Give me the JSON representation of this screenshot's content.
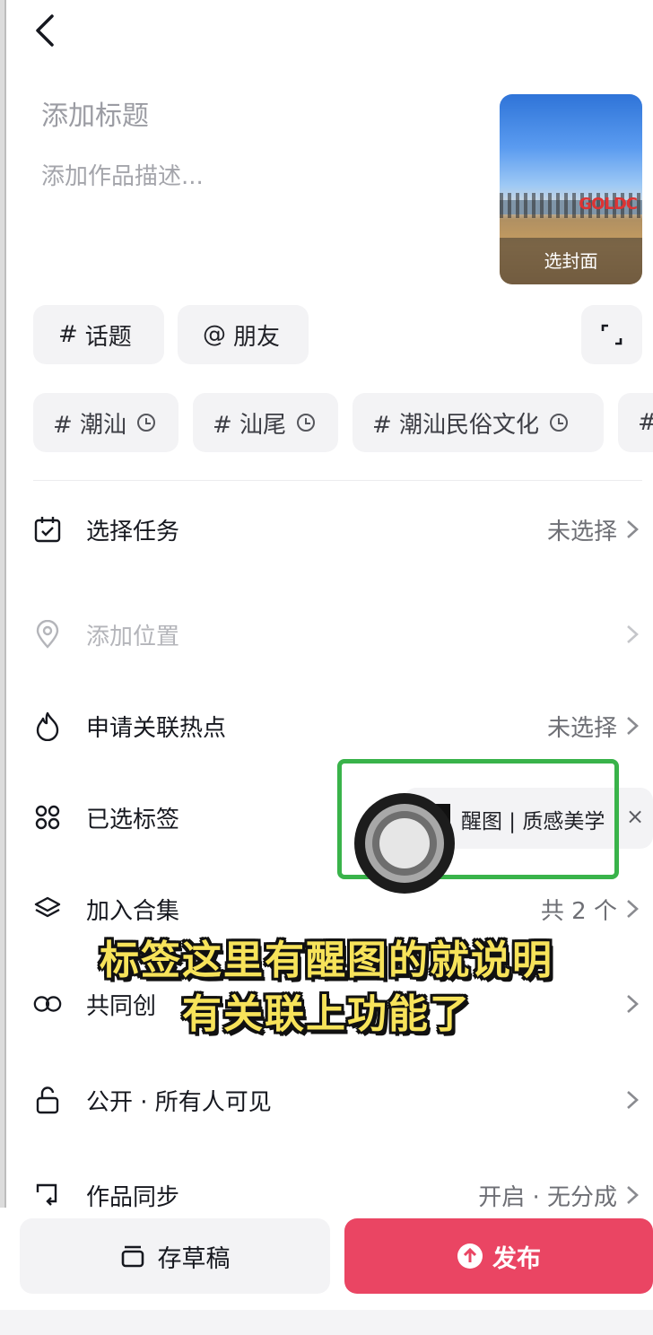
{
  "header": {
    "title_placeholder": "添加标题",
    "description_placeholder": "添加作品描述..."
  },
  "cover": {
    "label": "选封面",
    "sign_text": "GOLDC"
  },
  "toolbar": {
    "topic_label": "话题",
    "topic_icon": "#",
    "friend_label": "朋友",
    "friend_icon": "@"
  },
  "hashtags": [
    {
      "label": "# 潮汕"
    },
    {
      "label": "# 汕尾"
    },
    {
      "label": "# 潮汕民俗文化"
    },
    {
      "label": "#"
    }
  ],
  "settings": {
    "task": {
      "label": "选择任务",
      "value": "未选择"
    },
    "location": {
      "label": "添加位置"
    },
    "hotspot": {
      "label": "申请关联热点",
      "value": "未选择"
    },
    "selected_tags": {
      "label": "已选标签",
      "tag_text": "醒图 | 质感美学",
      "remove": "×"
    },
    "collection": {
      "label": "加入合集",
      "value": "共 2 个"
    },
    "co_create": {
      "label": "共同创"
    },
    "visibility": {
      "label": "公开 · 所有人可见"
    },
    "sync": {
      "label": "作品同步",
      "value": "开启 · 无分成"
    }
  },
  "caption": {
    "line1": "标签这里有醒图的就说明",
    "line2": "有关联上功能了"
  },
  "actions": {
    "draft_label": "存草稿",
    "publish_label": "发布"
  },
  "colors": {
    "publish": "#ea4563",
    "highlight_box": "#39b34a",
    "caption_text": "#f7e35a"
  }
}
